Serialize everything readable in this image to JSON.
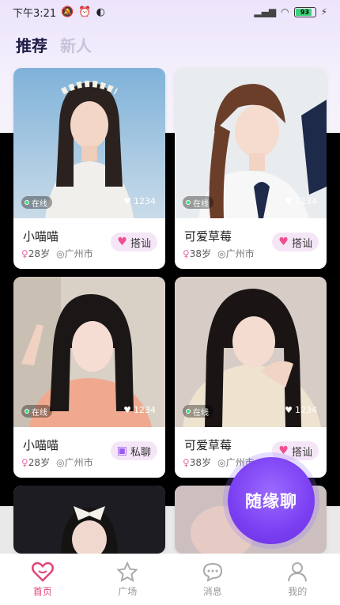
{
  "status_bar": {
    "time": "下午3:21",
    "battery": "93"
  },
  "tabs": [
    {
      "label": "推荐",
      "active": true
    },
    {
      "label": "新人",
      "active": false
    }
  ],
  "cards": [
    {
      "name": "小喵喵",
      "age": "28岁",
      "city": "广州市",
      "online": "在线",
      "likes": "1234",
      "action": "搭讪",
      "action_icon": "heart-icon"
    },
    {
      "name": "可爱草莓",
      "age": "38岁",
      "city": "广州市",
      "online": "在线",
      "likes": "1234",
      "action": "搭讪",
      "action_icon": "heart-icon"
    },
    {
      "name": "小喵喵",
      "age": "28岁",
      "city": "广州市",
      "online": "在线",
      "likes": "1234",
      "action": "私聊",
      "action_icon": "chat-icon"
    },
    {
      "name": "可爱草莓",
      "age": "38岁",
      "city": "广州市",
      "online": "在线",
      "likes": "1234",
      "action": "搭讪",
      "action_icon": "heart-icon"
    }
  ],
  "random_chat": {
    "label": "随缘聊"
  },
  "nav": [
    {
      "label": "首页",
      "icon": "heart-home-icon",
      "active": true
    },
    {
      "label": "广场",
      "icon": "star-icon",
      "active": false
    },
    {
      "label": "消息",
      "icon": "message-icon",
      "active": false
    },
    {
      "label": "我的",
      "icon": "person-icon",
      "active": false
    }
  ],
  "colors": {
    "accent": "#e0457a",
    "purple": "#7b3ff2",
    "tab_active": "#1e1b46"
  }
}
